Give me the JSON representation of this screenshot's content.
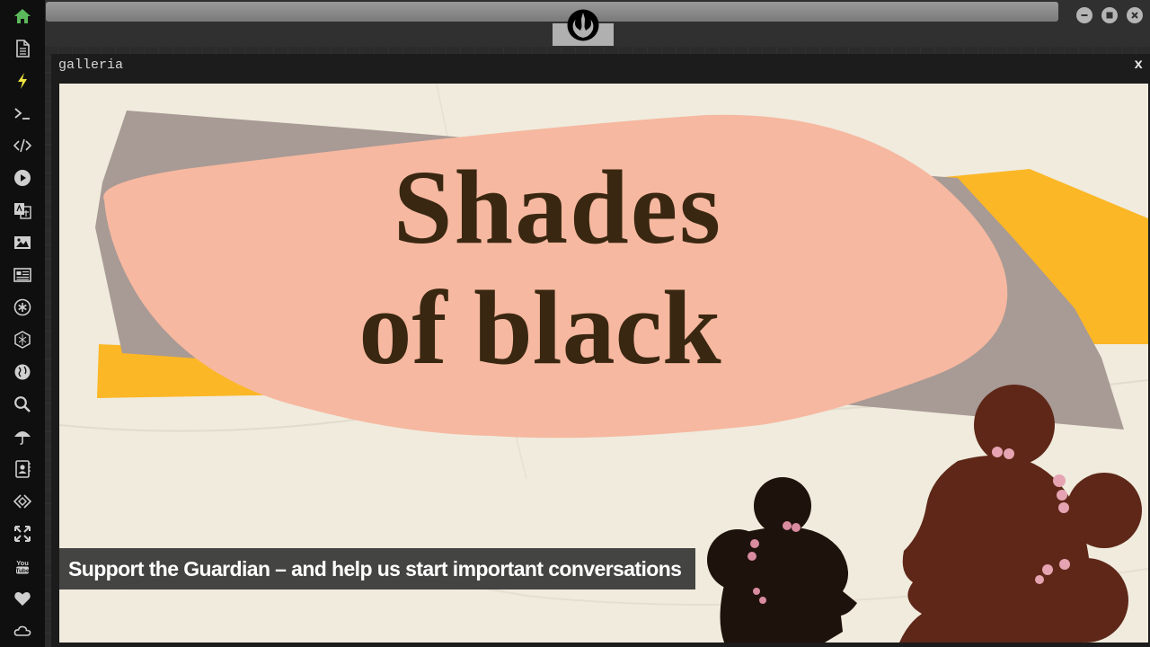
{
  "sidebar": {
    "items": [
      {
        "name": "home-icon",
        "label": "Home"
      },
      {
        "name": "document-icon",
        "label": "Documents"
      },
      {
        "name": "lightning-icon",
        "label": "Quick actions"
      },
      {
        "name": "terminal-icon",
        "label": "Terminal"
      },
      {
        "name": "code-icon",
        "label": "Code"
      },
      {
        "name": "play-icon",
        "label": "Media player"
      },
      {
        "name": "translate-icon",
        "label": "Translate"
      },
      {
        "name": "image-icon",
        "label": "Gallery"
      },
      {
        "name": "news-icon",
        "label": "News"
      },
      {
        "name": "asterisk-icon",
        "label": "Settings"
      },
      {
        "name": "hexagon-icon",
        "label": "Apps"
      },
      {
        "name": "globe-icon",
        "label": "Web"
      },
      {
        "name": "search-icon",
        "label": "Search"
      },
      {
        "name": "umbrella-icon",
        "label": "Weather"
      },
      {
        "name": "contacts-icon",
        "label": "Contacts"
      },
      {
        "name": "link-icon",
        "label": "Links"
      },
      {
        "name": "fullscreen-icon",
        "label": "Fullscreen"
      },
      {
        "name": "youtube-icon",
        "label": "YouTube"
      },
      {
        "name": "heart-icon",
        "label": "Favorites"
      },
      {
        "name": "cloud-icon",
        "label": "Cloud"
      }
    ],
    "active_color": "#5cb85c",
    "accent_color": "#f0e442"
  },
  "window": {
    "title": "galleria",
    "close_label": "x"
  },
  "artwork": {
    "headline_line1": "Shades",
    "headline_line2": "of black",
    "caption": "Support the Guardian – and help us start important conversations"
  }
}
